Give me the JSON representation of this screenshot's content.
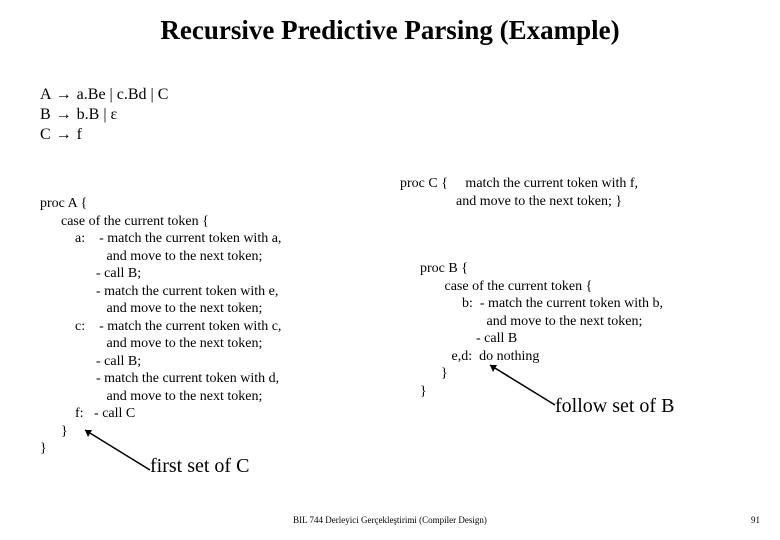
{
  "title": "Recursive Predictive Parsing (Example)",
  "grammar": {
    "l1_left": "A",
    "l1_right": "a.Be | c.Bd  |  C",
    "l2_left": "B",
    "l2_right": "b.B | ε",
    "l3_left": "C",
    "l3_right": "f",
    "arrow": "→"
  },
  "procA": "proc A {\n      case of the current token {\n          a:    - match the current token with a,\n                   and move to the next token;\n                - call B;\n                - match the current token with e,\n                   and move to the next token;\n          c:    - match the current token with c,\n                   and move to the next token;\n                - call B;\n                - match the current token with d,\n                   and move to the next token;\n          f:   - call C\n      }\n}",
  "procC": "proc C {     match the current token with f,\n                and move to the next token; }",
  "procB": "proc B {\n       case of the current token {\n            b:  - match the current token with b,\n                   and move to the next token;\n                - call B\n         e,d:  do nothing\n      }\n}",
  "first_label": "first set of C",
  "follow_label": "follow set of B",
  "footer_center": "BIL 744 Derleyici Gerçekleştirimi (Compiler Design)",
  "footer_page": "91"
}
